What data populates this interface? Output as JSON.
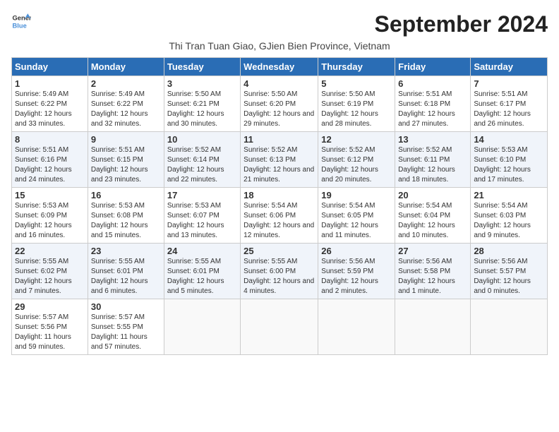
{
  "header": {
    "logo_line1": "General",
    "logo_line2": "Blue",
    "month_title": "September 2024",
    "subtitle": "Thi Tran Tuan Giao, GJien Bien Province, Vietnam"
  },
  "weekdays": [
    "Sunday",
    "Monday",
    "Tuesday",
    "Wednesday",
    "Thursday",
    "Friday",
    "Saturday"
  ],
  "weeks": [
    [
      {
        "day": "1",
        "sunrise": "5:49 AM",
        "sunset": "6:22 PM",
        "daylight": "12 hours and 33 minutes."
      },
      {
        "day": "2",
        "sunrise": "5:49 AM",
        "sunset": "6:22 PM",
        "daylight": "12 hours and 32 minutes."
      },
      {
        "day": "3",
        "sunrise": "5:50 AM",
        "sunset": "6:21 PM",
        "daylight": "12 hours and 30 minutes."
      },
      {
        "day": "4",
        "sunrise": "5:50 AM",
        "sunset": "6:20 PM",
        "daylight": "12 hours and 29 minutes."
      },
      {
        "day": "5",
        "sunrise": "5:50 AM",
        "sunset": "6:19 PM",
        "daylight": "12 hours and 28 minutes."
      },
      {
        "day": "6",
        "sunrise": "5:51 AM",
        "sunset": "6:18 PM",
        "daylight": "12 hours and 27 minutes."
      },
      {
        "day": "7",
        "sunrise": "5:51 AM",
        "sunset": "6:17 PM",
        "daylight": "12 hours and 26 minutes."
      }
    ],
    [
      {
        "day": "8",
        "sunrise": "5:51 AM",
        "sunset": "6:16 PM",
        "daylight": "12 hours and 24 minutes."
      },
      {
        "day": "9",
        "sunrise": "5:51 AM",
        "sunset": "6:15 PM",
        "daylight": "12 hours and 23 minutes."
      },
      {
        "day": "10",
        "sunrise": "5:52 AM",
        "sunset": "6:14 PM",
        "daylight": "12 hours and 22 minutes."
      },
      {
        "day": "11",
        "sunrise": "5:52 AM",
        "sunset": "6:13 PM",
        "daylight": "12 hours and 21 minutes."
      },
      {
        "day": "12",
        "sunrise": "5:52 AM",
        "sunset": "6:12 PM",
        "daylight": "12 hours and 20 minutes."
      },
      {
        "day": "13",
        "sunrise": "5:52 AM",
        "sunset": "6:11 PM",
        "daylight": "12 hours and 18 minutes."
      },
      {
        "day": "14",
        "sunrise": "5:53 AM",
        "sunset": "6:10 PM",
        "daylight": "12 hours and 17 minutes."
      }
    ],
    [
      {
        "day": "15",
        "sunrise": "5:53 AM",
        "sunset": "6:09 PM",
        "daylight": "12 hours and 16 minutes."
      },
      {
        "day": "16",
        "sunrise": "5:53 AM",
        "sunset": "6:08 PM",
        "daylight": "12 hours and 15 minutes."
      },
      {
        "day": "17",
        "sunrise": "5:53 AM",
        "sunset": "6:07 PM",
        "daylight": "12 hours and 13 minutes."
      },
      {
        "day": "18",
        "sunrise": "5:54 AM",
        "sunset": "6:06 PM",
        "daylight": "12 hours and 12 minutes."
      },
      {
        "day": "19",
        "sunrise": "5:54 AM",
        "sunset": "6:05 PM",
        "daylight": "12 hours and 11 minutes."
      },
      {
        "day": "20",
        "sunrise": "5:54 AM",
        "sunset": "6:04 PM",
        "daylight": "12 hours and 10 minutes."
      },
      {
        "day": "21",
        "sunrise": "5:54 AM",
        "sunset": "6:03 PM",
        "daylight": "12 hours and 9 minutes."
      }
    ],
    [
      {
        "day": "22",
        "sunrise": "5:55 AM",
        "sunset": "6:02 PM",
        "daylight": "12 hours and 7 minutes."
      },
      {
        "day": "23",
        "sunrise": "5:55 AM",
        "sunset": "6:01 PM",
        "daylight": "12 hours and 6 minutes."
      },
      {
        "day": "24",
        "sunrise": "5:55 AM",
        "sunset": "6:01 PM",
        "daylight": "12 hours and 5 minutes."
      },
      {
        "day": "25",
        "sunrise": "5:55 AM",
        "sunset": "6:00 PM",
        "daylight": "12 hours and 4 minutes."
      },
      {
        "day": "26",
        "sunrise": "5:56 AM",
        "sunset": "5:59 PM",
        "daylight": "12 hours and 2 minutes."
      },
      {
        "day": "27",
        "sunrise": "5:56 AM",
        "sunset": "5:58 PM",
        "daylight": "12 hours and 1 minute."
      },
      {
        "day": "28",
        "sunrise": "5:56 AM",
        "sunset": "5:57 PM",
        "daylight": "12 hours and 0 minutes."
      }
    ],
    [
      {
        "day": "29",
        "sunrise": "5:57 AM",
        "sunset": "5:56 PM",
        "daylight": "11 hours and 59 minutes."
      },
      {
        "day": "30",
        "sunrise": "5:57 AM",
        "sunset": "5:55 PM",
        "daylight": "11 hours and 57 minutes."
      },
      null,
      null,
      null,
      null,
      null
    ]
  ],
  "labels": {
    "sunrise": "Sunrise:",
    "sunset": "Sunset:",
    "daylight": "Daylight:"
  }
}
